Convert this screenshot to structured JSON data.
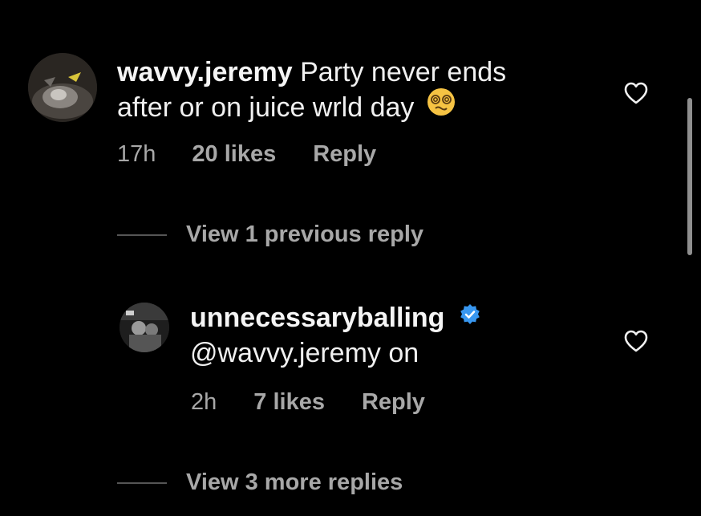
{
  "comments": [
    {
      "username": "wavvy.jeremy",
      "text_line1": "Party never ends",
      "text_line2": "after or on juice wrld day",
      "emoji_name": "dizzy-face-emoji",
      "time": "17h",
      "likes": "20 likes",
      "reply_label": "Reply",
      "view_replies": "View 1 previous reply"
    },
    {
      "username": "unnecessaryballing",
      "verified": true,
      "text": "@wavvy.jeremy on",
      "time": "2h",
      "likes": "7 likes",
      "reply_label": "Reply",
      "view_replies": "View 3 more replies"
    }
  ],
  "colors": {
    "background": "#000000",
    "text": "#f5f5f5",
    "secondary_text": "#a8a8a8",
    "verified_blue": "#3897f0",
    "scrollbar": "#8f8f8f"
  },
  "icons": [
    "heart-outline-icon",
    "verified-badge-icon"
  ]
}
